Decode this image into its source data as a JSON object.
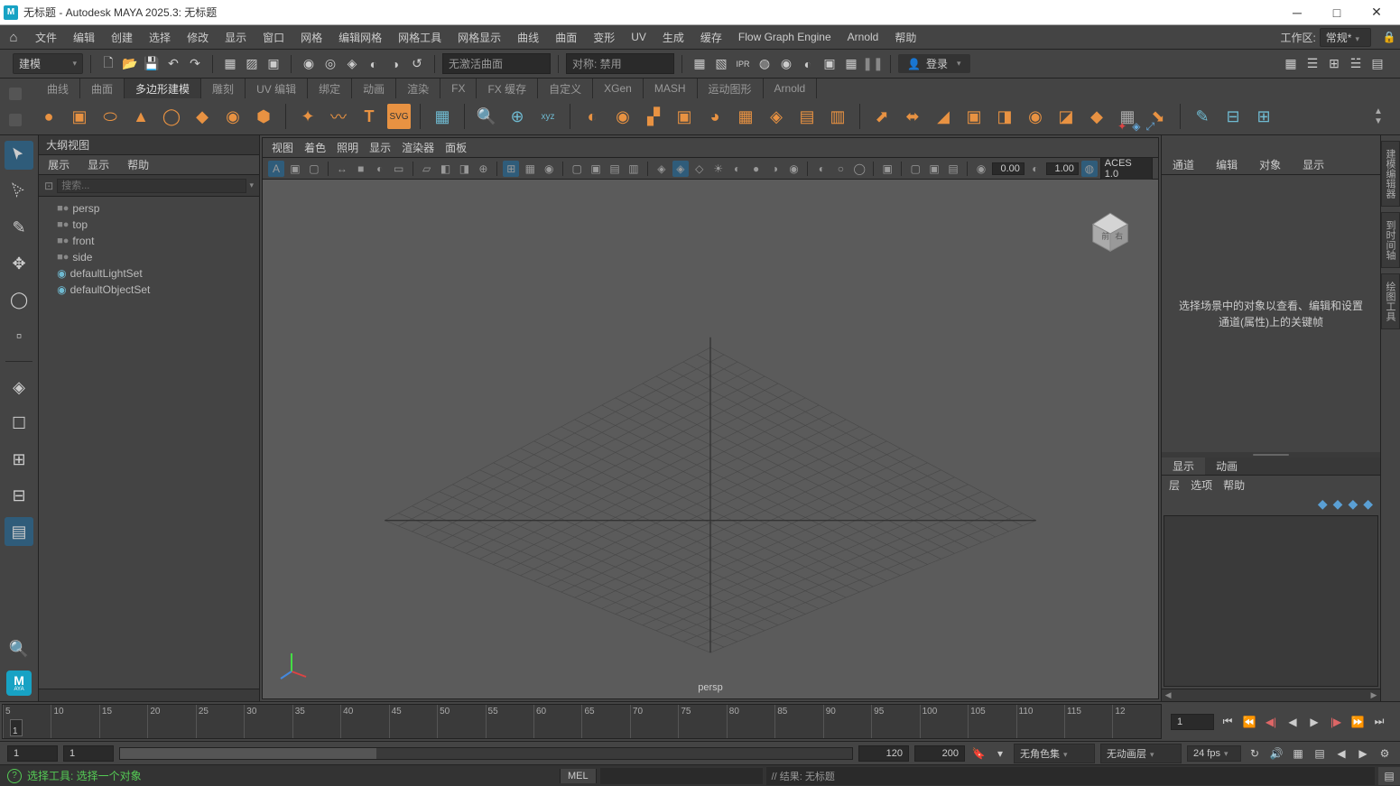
{
  "titlebar": {
    "title": "无标题 - Autodesk MAYA 2025.3: 无标题"
  },
  "menubar": {
    "items": [
      "文件",
      "编辑",
      "创建",
      "选择",
      "修改",
      "显示",
      "窗口",
      "网格",
      "编辑网格",
      "网格工具",
      "网格显示",
      "曲线",
      "曲面",
      "变形",
      "UV",
      "生成",
      "缓存",
      "Flow Graph Engine",
      "Arnold",
      "帮助"
    ],
    "workspace_label": "工作区:",
    "workspace_value": "常规*"
  },
  "toolbar": {
    "mode": "建模",
    "curve_surface": "无激活曲面",
    "symmetry": "对称: 禁用",
    "login": "登录"
  },
  "shelf": {
    "tabs": [
      "曲线",
      "曲面",
      "多边形建模",
      "雕刻",
      "UV 编辑",
      "绑定",
      "动画",
      "渲染",
      "FX",
      "FX 缓存",
      "自定义",
      "XGen",
      "MASH",
      "运动图形",
      "Arnold"
    ],
    "active_tab": 2
  },
  "outliner": {
    "title": "大纲视图",
    "menus": [
      "展示",
      "显示",
      "帮助"
    ],
    "search_placeholder": "搜索...",
    "items": [
      {
        "icon": "cam",
        "label": "persp"
      },
      {
        "icon": "cam",
        "label": "top"
      },
      {
        "icon": "cam",
        "label": "front"
      },
      {
        "icon": "cam",
        "label": "side"
      },
      {
        "icon": "set",
        "label": "defaultLightSet"
      },
      {
        "icon": "set",
        "label": "defaultObjectSet"
      }
    ]
  },
  "viewport": {
    "menus": [
      "视图",
      "着色",
      "照明",
      "显示",
      "渲染器",
      "面板"
    ],
    "near": "0.00",
    "far": "1.00",
    "colorspace": "ACES 1.0",
    "camera_label": "persp",
    "cube_front": "前",
    "cube_right": "右"
  },
  "channelbox": {
    "tabs": [
      "通道",
      "编辑",
      "对象",
      "显示"
    ],
    "message": "选择场景中的对象以查看、编辑和设置通道(属性)上的关键帧"
  },
  "layers": {
    "tabs": [
      "显示",
      "动画"
    ],
    "menu": [
      "层",
      "选项",
      "帮助"
    ]
  },
  "right_docks": [
    "建模编辑器",
    "到时间轴",
    "绘图工具"
  ],
  "timeline": {
    "ticks": [
      "5",
      "10",
      "15",
      "20",
      "25",
      "30",
      "35",
      "40",
      "45",
      "50",
      "55",
      "60",
      "65",
      "70",
      "75",
      "80",
      "85",
      "90",
      "95",
      "100",
      "105",
      "110",
      "115",
      "12"
    ],
    "current": "1",
    "display": "1"
  },
  "range": {
    "start_outer": "1",
    "start_inner": "1",
    "end_inner": "120",
    "end_outer": "200",
    "charset": "无角色集",
    "animlayer": "无动画层",
    "fps": "24 fps"
  },
  "cmdline": {
    "status": "选择工具: 选择一个对象",
    "lang": "MEL",
    "result_prefix": "// 结果: ",
    "result_value": "无标题"
  }
}
